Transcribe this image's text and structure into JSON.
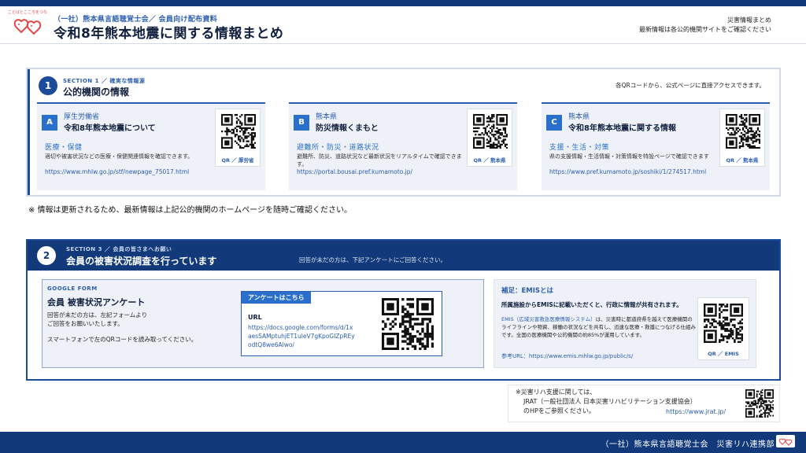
{
  "header": {
    "logo_text": "ことばとこころをつなぐ",
    "org_sub": "（一社）熊本県言語聴覚士会／ 会員向け配布資料",
    "title": "令和8年熊本地震に関する情報まとめ",
    "right_line1": "災害情報まとめ",
    "right_line2": "最新情報は各公的機関サイトをご確認ください"
  },
  "section1": {
    "number": "1",
    "small_label": "SECTION 1 ／ 確実な情報源",
    "title": "公的機関の情報",
    "hint": "各QRコードから、公式ページに直接アクセスできます。",
    "cards": [
      {
        "badge": "A",
        "org": "厚生労働省",
        "title": "令和8年熊本地震について",
        "category": "医療・保健",
        "desc": "適切や被害状況などの医療・保健関連情報を確認できます。",
        "url": "https://www.mhlw.go.jp/stf/newpage_75017.html",
        "qr_label": "QR ／ 厚労省"
      },
      {
        "badge": "B",
        "org": "熊本県",
        "title": "防災情報くまもと",
        "category": "避難所・防災・道路状況",
        "desc": "避難所、防災、道路状況など最新状況をリアルタイムで確認できます。",
        "url": "https://portal.bousai.pref.kumamoto.jp/",
        "qr_label": "QR ／ 熊本県"
      },
      {
        "badge": "C",
        "org": "熊本県",
        "title": "令和8年熊本地震に関する情報",
        "category": "支援・生活・対策",
        "desc": "県の支援情報・生活情報・対策情報を特設ページで確認できます",
        "url": "https://www.pref.kumamoto.jp/soshiki/1/274517.html",
        "qr_label": "QR ／ 熊本県"
      }
    ]
  },
  "notice": "※ 情報は更新されるため、最新情報は上記公的機関のホームページを随時ご確認ください。",
  "section3": {
    "number": "2",
    "small_label": "SECTION 3 ／ 会員の皆さまへお願い",
    "title": "会員の被害状況調査を行っています",
    "hint": "回答が未だの方は、下記アンケートにご回答ください。",
    "form": {
      "label": "GOOGLE FORM",
      "title": "会員 被害状況アンケート",
      "line1": "回答が未だの方は、左記フォームより",
      "line2": "ご回答をお願いいたします。",
      "line3": "スマートフォンで左のQRコードを読み取ってください。",
      "link_tag": "アンケートはこちら",
      "url_label": "URL",
      "url": "https://docs.google.com/forms/d/1xaesSAMptuhjET1uleV7gKpoGIZpREyodtQ8we6Alwo/"
    },
    "emis": {
      "label": "補足：EMISとは",
      "lead": "所属施設からEMISに記載いただくと、行政に情報が共有されます。",
      "body_accent": "EMIS（広域災害救急医療情報システム）",
      "body": "は、災害時に都道府県を越えて医療機関のライフラインや物資、稼働の状況などを共有し、迅速な医療・救護につなげる仕組みです。全国の医療機関や公的機関の約85%が運用しています。",
      "ref": "参考URL：https://www.emis.mhlw.go.jp/public/s/",
      "qr_label": "QR ／ EMIS"
    }
  },
  "footnote": {
    "line1": "※災害リハ支援に関しては、",
    "line2": "JRAT（一般社団法人 日本災害リハビリテーション支援協会）",
    "line3": "のHPをご参照ください。",
    "url": "https://www.jrat.jp/"
  },
  "footer": {
    "text": "（一社）熊本県言語聴覚士会　災害リハ連携部"
  },
  "colors": {
    "navy": "#123a7a",
    "accent": "#2a5db0",
    "panel": "#eef2f8"
  }
}
